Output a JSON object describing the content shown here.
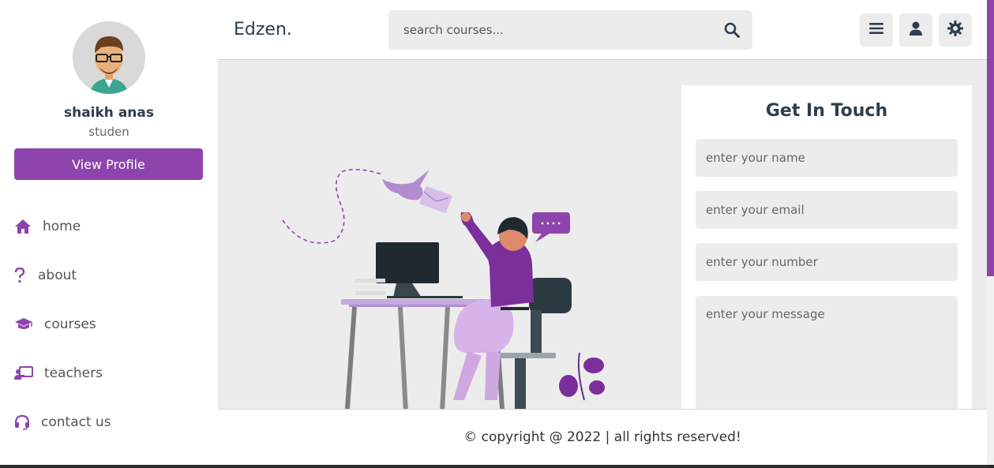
{
  "app": {
    "logo": "Edzen."
  },
  "search": {
    "placeholder": "search courses..."
  },
  "header": {
    "icons": [
      "menu-icon",
      "user-icon",
      "gear-icon"
    ]
  },
  "profile": {
    "name": "shaikh anas",
    "role": "studen",
    "button_label": "View Profile"
  },
  "sidebar": {
    "items": [
      {
        "label": "home",
        "icon": "home-icon"
      },
      {
        "label": "about",
        "icon": "question-icon"
      },
      {
        "label": "courses",
        "icon": "graduation-cap-icon"
      },
      {
        "label": "teachers",
        "icon": "chalkboard-teacher-icon"
      },
      {
        "label": "contact us",
        "icon": "headset-icon"
      }
    ]
  },
  "contact": {
    "title": "Get In Touch",
    "name_placeholder": "enter your name",
    "email_placeholder": "enter your email",
    "number_placeholder": "enter your number",
    "message_placeholder": "enter your message"
  },
  "footer": {
    "text": "© copyright @ 2022 | all rights reserved!"
  },
  "colors": {
    "accent": "#8e44ad",
    "background": "#ececec",
    "text": "#2c3e50"
  }
}
